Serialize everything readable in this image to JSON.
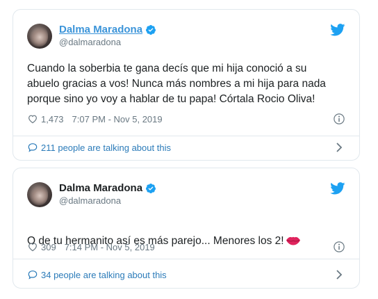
{
  "tweets": [
    {
      "author": {
        "name": "Dalma Maradona",
        "handle": "@dalmaradona"
      },
      "text": "Cuando la soberbia te gana decís que mi hija conoció a su\nabuelo gracias a vos! Nunca más nombres a mi hija para nada\nporque sino yo voy a hablar de tu papa! Córtala Rocio Oliva!",
      "likes": "1,473",
      "timestamp": "7:07 PM - Nov 5, 2019",
      "talking": "211 people are talking about this",
      "name_hovered": true
    },
    {
      "author": {
        "name": "Dalma Maradona",
        "handle": "@dalmaradona"
      },
      "text": "O de tu hermanito así es más parejo... Menores los 2!",
      "likes": "309",
      "timestamp": "7:14 PM - Nov 5, 2019",
      "talking": "34 people are talking about this",
      "name_hovered": false
    }
  ],
  "icons": {
    "verified": "verified-badge-icon",
    "twitter": "twitter-bird-icon",
    "like": "heart-icon",
    "info": "info-icon",
    "conversation": "speech-bubble-icon",
    "expand": "chevron-right-icon",
    "emoji": "kiss-lips-emoji"
  },
  "colors": {
    "brand_blue": "#1da1f2",
    "link_blue": "#2b7bb9",
    "text": "#1c2022",
    "muted": "#697882",
    "border": "#e1e8ed",
    "kiss_red": "#e0245e"
  }
}
